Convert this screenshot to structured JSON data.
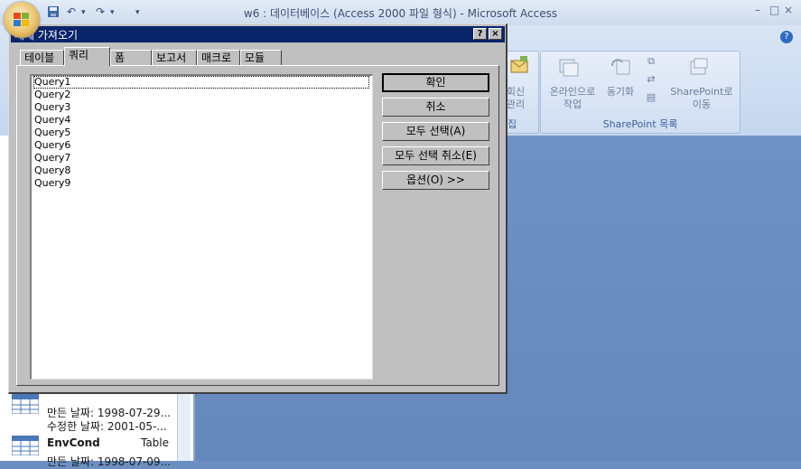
{
  "app": {
    "title": "w6 : 데이터베이스 (Access 2000 파일 형식) - Microsoft Access",
    "qat_separator": "▾",
    "help": "?"
  },
  "ribbon": {
    "collect_group": {
      "button_label_1": "회신",
      "button_label_2": "관리",
      "caption": "집"
    },
    "sharepoint_group": {
      "caption": "SharePoint 목록",
      "online_label_1": "온라인으로",
      "online_label_2": "작업",
      "sync_label": "동기화",
      "move_label_1": "SharePoint로",
      "move_label_2": "이동"
    }
  },
  "navigation_pane": {
    "partial_item": {
      "created": "만든 날짜: 1998-07-29...",
      "modified": "수정한 날짜: 2001-05-..."
    },
    "item": {
      "name": "EnvCond",
      "type": "Table",
      "created": "만든 날짜: 1998-07-09..."
    }
  },
  "dialog": {
    "title": "개체 가져오기",
    "help_btn": "?",
    "close_btn": "×",
    "tabs": [
      {
        "label": "테이블",
        "active": false
      },
      {
        "label": "쿼리",
        "active": true
      },
      {
        "label": "폼",
        "active": false
      },
      {
        "label": "보고서",
        "active": false
      },
      {
        "label": "매크로",
        "active": false
      },
      {
        "label": "모듈",
        "active": false
      }
    ],
    "items": [
      "Query1",
      "Query2",
      "Query3",
      "Query4",
      "Query5",
      "Query6",
      "Query7",
      "Query8",
      "Query9"
    ],
    "buttons": {
      "ok": "확인",
      "cancel": "취소",
      "select_all": "모두 선택(A)",
      "deselect_all": "모두 선택 취소(E)",
      "options": "옵션(O) >>"
    }
  },
  "colors": {
    "dialog_title": "#0a246a",
    "dialog_face": "#c0c0c0",
    "workspace": "#6b8fc2"
  }
}
